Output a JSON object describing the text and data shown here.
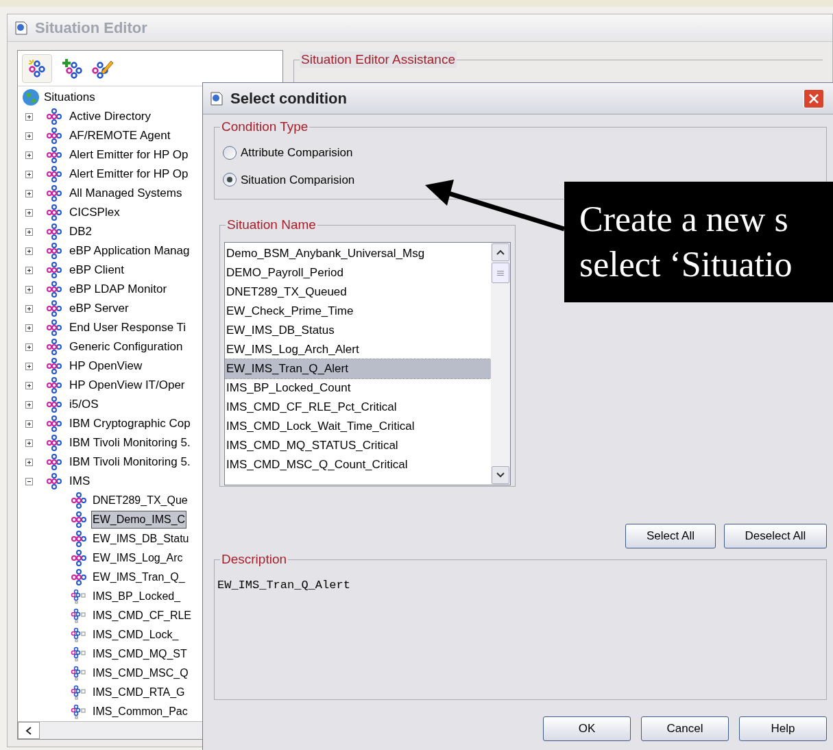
{
  "main_window": {
    "title": "Situation Editor"
  },
  "tree": {
    "root": "Situations",
    "items": [
      {
        "label": "Active Directory",
        "expanded": false,
        "selected": false
      },
      {
        "label": "AF/REMOTE Agent",
        "expanded": false,
        "selected": false
      },
      {
        "label": "Alert Emitter for HP Op",
        "expanded": false,
        "selected": false
      },
      {
        "label": "Alert Emitter for HP Op",
        "expanded": false,
        "selected": false
      },
      {
        "label": "All Managed Systems",
        "expanded": false,
        "selected": false
      },
      {
        "label": "CICSPlex",
        "expanded": false,
        "selected": false
      },
      {
        "label": "DB2",
        "expanded": false,
        "selected": false
      },
      {
        "label": "eBP Application Manag",
        "expanded": false,
        "selected": false
      },
      {
        "label": "eBP Client",
        "expanded": false,
        "selected": false
      },
      {
        "label": "eBP LDAP Monitor",
        "expanded": false,
        "selected": false
      },
      {
        "label": "eBP Server",
        "expanded": false,
        "selected": false
      },
      {
        "label": "End User Response Ti",
        "expanded": false,
        "selected": false
      },
      {
        "label": "Generic Configuration",
        "expanded": false,
        "selected": false
      },
      {
        "label": "HP OpenView",
        "expanded": false,
        "selected": false
      },
      {
        "label": "HP OpenView IT/Oper",
        "expanded": false,
        "selected": false
      },
      {
        "label": "i5/OS",
        "expanded": false,
        "selected": false
      },
      {
        "label": "IBM Cryptographic Cop",
        "expanded": false,
        "selected": false
      },
      {
        "label": "IBM Tivoli Monitoring 5.",
        "expanded": false,
        "selected": false
      },
      {
        "label": "IBM Tivoli Monitoring 5.",
        "expanded": false,
        "selected": false
      },
      {
        "label": "IMS",
        "expanded": true,
        "selected": false,
        "children": [
          {
            "label": "DNET289_TX_Que",
            "kind": "situation",
            "selected": false
          },
          {
            "label": "EW_Demo_IMS_C",
            "kind": "situation",
            "selected": true
          },
          {
            "label": "EW_IMS_DB_Statu",
            "kind": "situation",
            "selected": false
          },
          {
            "label": "EW_IMS_Log_Arc",
            "kind": "situation",
            "selected": false
          },
          {
            "label": "EW_IMS_Tran_Q_",
            "kind": "situation",
            "selected": false
          },
          {
            "label": "IMS_BP_Locked_",
            "kind": "member",
            "selected": false
          },
          {
            "label": "IMS_CMD_CF_RLE",
            "kind": "member",
            "selected": false
          },
          {
            "label": "IMS_CMD_Lock_",
            "kind": "member",
            "selected": false
          },
          {
            "label": "IMS_CMD_MQ_ST",
            "kind": "member",
            "selected": false
          },
          {
            "label": "IMS_CMD_MSC_Q",
            "kind": "member",
            "selected": false
          },
          {
            "label": "IMS_CMD_RTA_G",
            "kind": "member",
            "selected": false
          },
          {
            "label": "IMS_Common_Pac",
            "kind": "member",
            "selected": false
          }
        ]
      }
    ]
  },
  "assistance_panel": {
    "title": "Situation Editor Assistance"
  },
  "dialog": {
    "title": "Select condition",
    "condition_type": {
      "title": "Condition Type",
      "options": [
        {
          "label": "Attribute Comparision",
          "selected": false
        },
        {
          "label": "Situation Comparision",
          "selected": true
        }
      ]
    },
    "situation_name": {
      "title": "Situation Name",
      "items": [
        {
          "label": "Demo_BSM_Anybank_Universal_Msg",
          "selected": false
        },
        {
          "label": "DEMO_Payroll_Period",
          "selected": false
        },
        {
          "label": "DNET289_TX_Queued",
          "selected": false
        },
        {
          "label": "EW_Check_Prime_Time",
          "selected": false
        },
        {
          "label": "EW_IMS_DB_Status",
          "selected": false
        },
        {
          "label": "EW_IMS_Log_Arch_Alert",
          "selected": false
        },
        {
          "label": "EW_IMS_Tran_Q_Alert",
          "selected": true
        },
        {
          "label": "IMS_BP_Locked_Count",
          "selected": false
        },
        {
          "label": "IMS_CMD_CF_RLE_Pct_Critical",
          "selected": false
        },
        {
          "label": "IMS_CMD_Lock_Wait_Time_Critical",
          "selected": false
        },
        {
          "label": "IMS_CMD_MQ_STATUS_Critical",
          "selected": false
        },
        {
          "label": "IMS_CMD_MSC_Q_Count_Critical",
          "selected": false
        }
      ]
    },
    "list_buttons": [
      "Select All",
      "Deselect All"
    ],
    "description": {
      "title": "Description",
      "value": "EW_IMS_Tran_Q_Alert"
    },
    "buttons": [
      "OK",
      "Cancel",
      "Help"
    ]
  },
  "callout": {
    "lines": [
      "Create a new s",
      "select ‘Situatio"
    ]
  }
}
